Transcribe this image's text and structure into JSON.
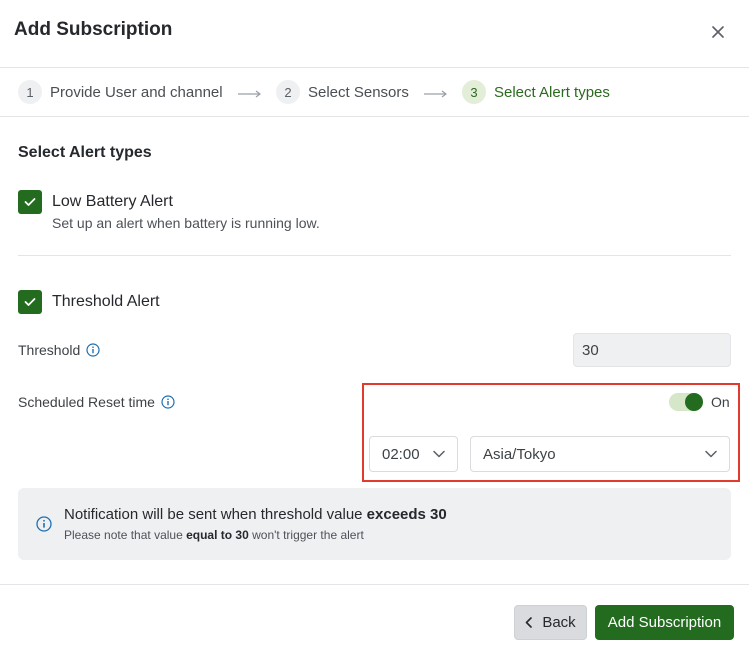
{
  "dialog": {
    "title": "Add Subscription",
    "close_icon": "close-icon"
  },
  "stepper": {
    "steps": [
      {
        "number": "1",
        "label": "Provide User and channel",
        "active": false
      },
      {
        "number": "2",
        "label": "Select Sensors",
        "active": false
      },
      {
        "number": "3",
        "label": "Select Alert types",
        "active": true
      }
    ]
  },
  "section": {
    "title": "Select Alert types"
  },
  "alerts": {
    "low_battery": {
      "checked": true,
      "label": "Low Battery Alert",
      "description": "Set up an alert when battery is running low."
    },
    "threshold": {
      "checked": true,
      "label": "Threshold Alert"
    }
  },
  "threshold_field": {
    "label": "Threshold",
    "value": "30"
  },
  "scheduled_reset": {
    "label": "Scheduled Reset time",
    "toggle_on": true,
    "toggle_label": "On",
    "time_value": "02:00",
    "timezone_value": "Asia/Tokyo"
  },
  "notice": {
    "main_prefix": "Notification will be sent when threshold value ",
    "main_bold": "exceeds 30",
    "sub_prefix": "Please note that value ",
    "sub_bold": "equal to 30",
    "sub_suffix": " won't trigger the alert"
  },
  "footer": {
    "back_label": "Back",
    "add_label": "Add Subscription"
  },
  "colors": {
    "primary_green": "#236b1e",
    "highlight_red": "#e23b2e",
    "info_blue": "#1f6fb2"
  }
}
